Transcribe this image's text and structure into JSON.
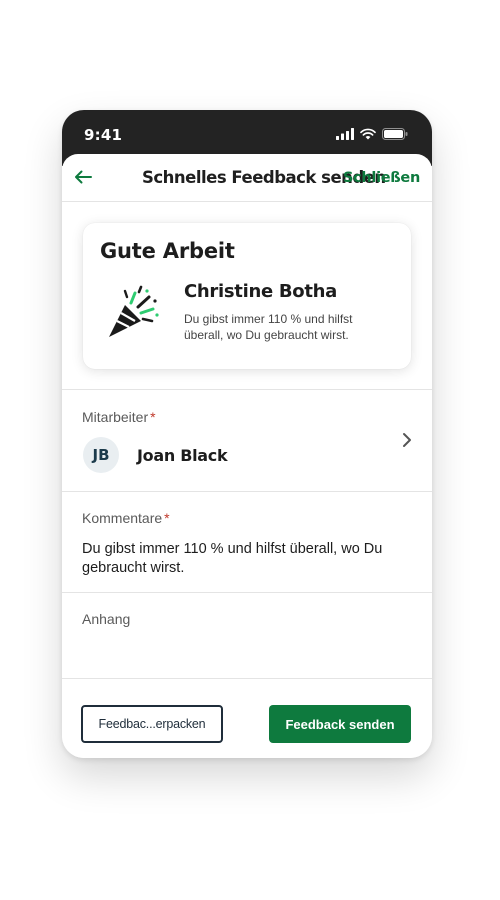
{
  "status_bar": {
    "time": "9:41",
    "icons": [
      "signal-icon",
      "wifi-icon",
      "battery-icon"
    ]
  },
  "nav": {
    "title": "Schnelles Feedback senden",
    "close_label": "Schließen",
    "back_icon": "arrow-left-icon"
  },
  "feedback_card": {
    "title": "Gute Arbeit",
    "icon": "party-popper-icon",
    "recipient_name": "Christine Botha",
    "message": "Du gibst immer 110 % und hilfst überall, wo Du gebraucht wirst."
  },
  "employee_field": {
    "label": "Mitarbeiter",
    "required_mark": "*",
    "avatar_initials": "JB",
    "value": "Joan Black"
  },
  "comments_field": {
    "label": "Kommentare",
    "required_mark": "*",
    "value": "Du gibst immer 110 % und hilfst überall, wo Du gebraucht wirst."
  },
  "attachment_field": {
    "label": "Anhang"
  },
  "actions": {
    "secondary_label": "Feedbac...erpacken",
    "primary_label": "Feedback senden"
  },
  "colors": {
    "accent_green": "#0e7a3e",
    "status_bar_bg": "#232323",
    "required_red": "#c0392b"
  }
}
